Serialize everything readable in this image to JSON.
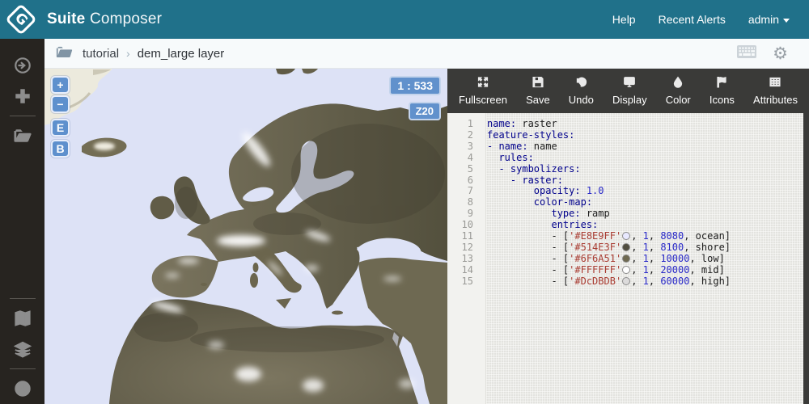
{
  "header": {
    "brand_bold": "Suite",
    "brand_light": "Composer",
    "logo_letter": "G",
    "nav": [
      {
        "id": "help",
        "label": "Help",
        "caret": false
      },
      {
        "id": "recent-alerts",
        "label": "Recent Alerts",
        "caret": false
      },
      {
        "id": "admin-menu",
        "label": "admin",
        "caret": true
      }
    ]
  },
  "breadcrumb": {
    "workspace": "tutorial",
    "separator": "›",
    "item": "dem_large layer"
  },
  "sidebar": {
    "top_items": [
      {
        "icon": "arrow-circle-icon"
      },
      {
        "icon": "plus-icon"
      },
      {
        "divider": true
      },
      {
        "icon": "folder-open-icon"
      }
    ],
    "bottom_items": [
      {
        "divider": true
      },
      {
        "icon": "map-icon"
      },
      {
        "icon": "layers-icon"
      },
      {
        "divider": true
      },
      {
        "icon": "clock-icon"
      }
    ]
  },
  "map": {
    "scale_badge": "1 : 533",
    "zoom_badge": "Z20",
    "zoom_in_label": "+",
    "zoom_out_label": "−",
    "e_button_label": "E",
    "b_button_label": "B",
    "ocean_color": "#dde2f6",
    "land_color": "#6f6a51",
    "land_dark_color": "#514e3f"
  },
  "toolbar": {
    "buttons": [
      {
        "icon": "fullscreen-icon",
        "label": "Fullscreen"
      },
      {
        "icon": "save-icon",
        "label": "Save"
      },
      {
        "icon": "undo-icon",
        "label": "Undo"
      },
      {
        "icon": "display-icon",
        "label": "Display"
      },
      {
        "icon": "color-icon",
        "label": "Color"
      },
      {
        "icon": "icons-icon",
        "label": "Icons"
      },
      {
        "icon": "attributes-icon",
        "label": "Attributes"
      }
    ]
  },
  "editor": {
    "lines": [
      {
        "num": 1,
        "tokens": [
          [
            "k",
            "name:"
          ],
          [
            "p",
            " raster"
          ]
        ]
      },
      {
        "num": 2,
        "tokens": [
          [
            "k",
            "feature-styles:"
          ]
        ]
      },
      {
        "num": 3,
        "tokens": [
          [
            "k",
            "- name:"
          ],
          [
            "p",
            " name"
          ]
        ]
      },
      {
        "num": 4,
        "tokens": [
          [
            "p",
            "  "
          ],
          [
            "k",
            "rules:"
          ]
        ]
      },
      {
        "num": 5,
        "tokens": [
          [
            "p",
            "  "
          ],
          [
            "k",
            "- symbolizers:"
          ]
        ]
      },
      {
        "num": 6,
        "tokens": [
          [
            "p",
            "    "
          ],
          [
            "k",
            "- raster:"
          ]
        ]
      },
      {
        "num": 7,
        "tokens": [
          [
            "p",
            "        "
          ],
          [
            "k",
            "opacity:"
          ],
          [
            "n",
            " 1.0"
          ]
        ]
      },
      {
        "num": 8,
        "tokens": [
          [
            "p",
            "        "
          ],
          [
            "k",
            "color-map:"
          ]
        ]
      },
      {
        "num": 9,
        "tokens": [
          [
            "p",
            "           "
          ],
          [
            "k",
            "type:"
          ],
          [
            "p",
            " ramp"
          ]
        ]
      },
      {
        "num": 10,
        "tokens": [
          [
            "p",
            "           "
          ],
          [
            "k",
            "entries:"
          ]
        ]
      },
      {
        "num": 11,
        "tokens": [
          [
            "p",
            "           - ["
          ],
          [
            "s",
            "'#E8E9FF'"
          ],
          [
            "w",
            "#E8E9FF"
          ],
          [
            "p",
            ", "
          ],
          [
            "n",
            "1"
          ],
          [
            "p",
            ", "
          ],
          [
            "n",
            "8080"
          ],
          [
            "p",
            ", ocean]"
          ]
        ]
      },
      {
        "num": 12,
        "tokens": [
          [
            "p",
            "           - ["
          ],
          [
            "s",
            "'#514E3F'"
          ],
          [
            "w",
            "#514E3F"
          ],
          [
            "p",
            ", "
          ],
          [
            "n",
            "1"
          ],
          [
            "p",
            ", "
          ],
          [
            "n",
            "8100"
          ],
          [
            "p",
            ", shore]"
          ]
        ]
      },
      {
        "num": 13,
        "tokens": [
          [
            "p",
            "           - ["
          ],
          [
            "s",
            "'#6F6A51'"
          ],
          [
            "w",
            "#6F6A51"
          ],
          [
            "p",
            ", "
          ],
          [
            "n",
            "1"
          ],
          [
            "p",
            ", "
          ],
          [
            "n",
            "10000"
          ],
          [
            "p",
            ", low]"
          ]
        ]
      },
      {
        "num": 14,
        "tokens": [
          [
            "p",
            "           - ["
          ],
          [
            "s",
            "'#FFFFFF'"
          ],
          [
            "w",
            "#FFFFFF"
          ],
          [
            "p",
            ", "
          ],
          [
            "n",
            "1"
          ],
          [
            "p",
            ", "
          ],
          [
            "n",
            "20000"
          ],
          [
            "p",
            ", mid]"
          ]
        ]
      },
      {
        "num": 15,
        "tokens": [
          [
            "p",
            "           - ["
          ],
          [
            "s",
            "'#DcDBDB'"
          ],
          [
            "w",
            "#DCDBDB"
          ],
          [
            "p",
            ", "
          ],
          [
            "n",
            "1"
          ],
          [
            "p",
            ", "
          ],
          [
            "n",
            "60000"
          ],
          [
            "p",
            ", high]"
          ]
        ]
      }
    ]
  },
  "colors": {
    "header_teal": "#20718a",
    "sidebar_dark": "#272420",
    "toolbar_dark": "#3a3a38",
    "accent_blue": "#6191cc"
  }
}
